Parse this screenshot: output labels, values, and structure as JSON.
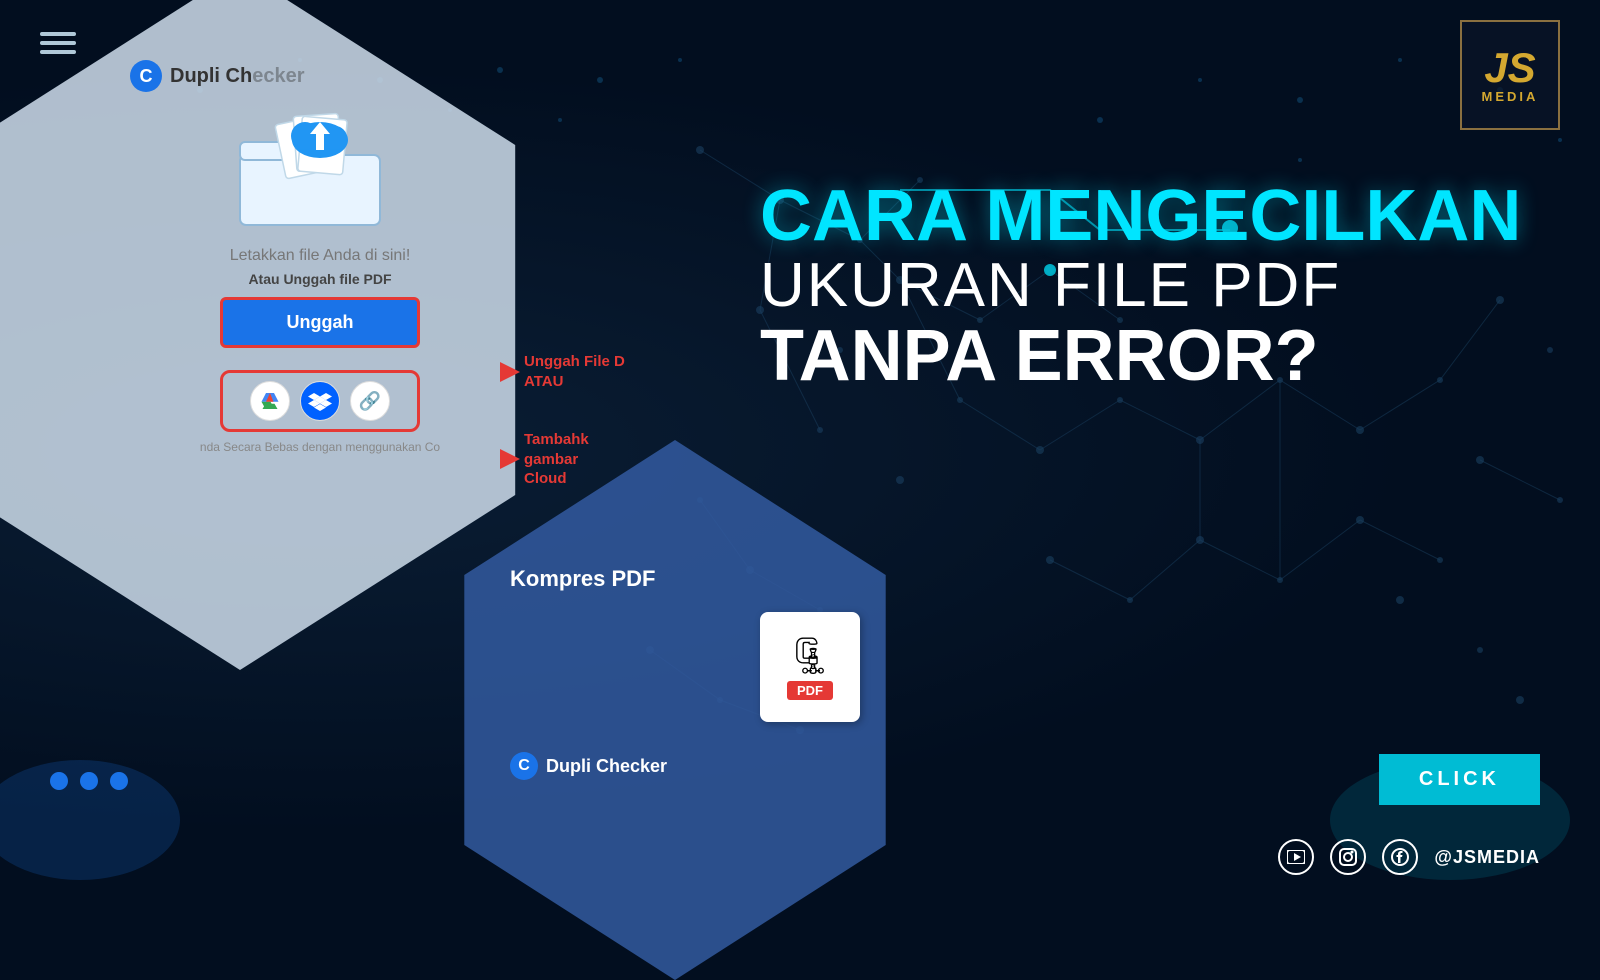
{
  "background": {
    "color": "#020e1f"
  },
  "logo": {
    "initials": "JS",
    "subtitle": "MEDIA"
  },
  "left_panel": {
    "dupli_checker_logo": "Dupli Ch",
    "drop_text": "Letakkan file Anda di sini!",
    "upload_label": "Atau Unggah file PDF",
    "upload_button": "Unggah",
    "annotation1_line1": "Unggah File D",
    "annotation1_line2": "ATAU",
    "annotation2_line1": "Tambahk",
    "annotation2_line2": "gambar",
    "annotation2_line3": "Cloud",
    "bottom_text": "nda Secara Bebas dengan menggunakan Co"
  },
  "bottom_right_panel": {
    "label": "Kompres PDF",
    "pdf_text": "PDF",
    "dupli_checker": "Dupli Checker"
  },
  "main_title": {
    "line1": "CARA MENGECILKAN",
    "line2": "UKURAN FILE PDF",
    "line3": "TANPA ERROR?"
  },
  "click_button": {
    "label": "CLiCK"
  },
  "social": {
    "handle": "@JSMEDIA",
    "icons": [
      "youtube",
      "instagram",
      "facebook"
    ]
  },
  "dots": [
    "dot1",
    "dot2",
    "dot3"
  ]
}
